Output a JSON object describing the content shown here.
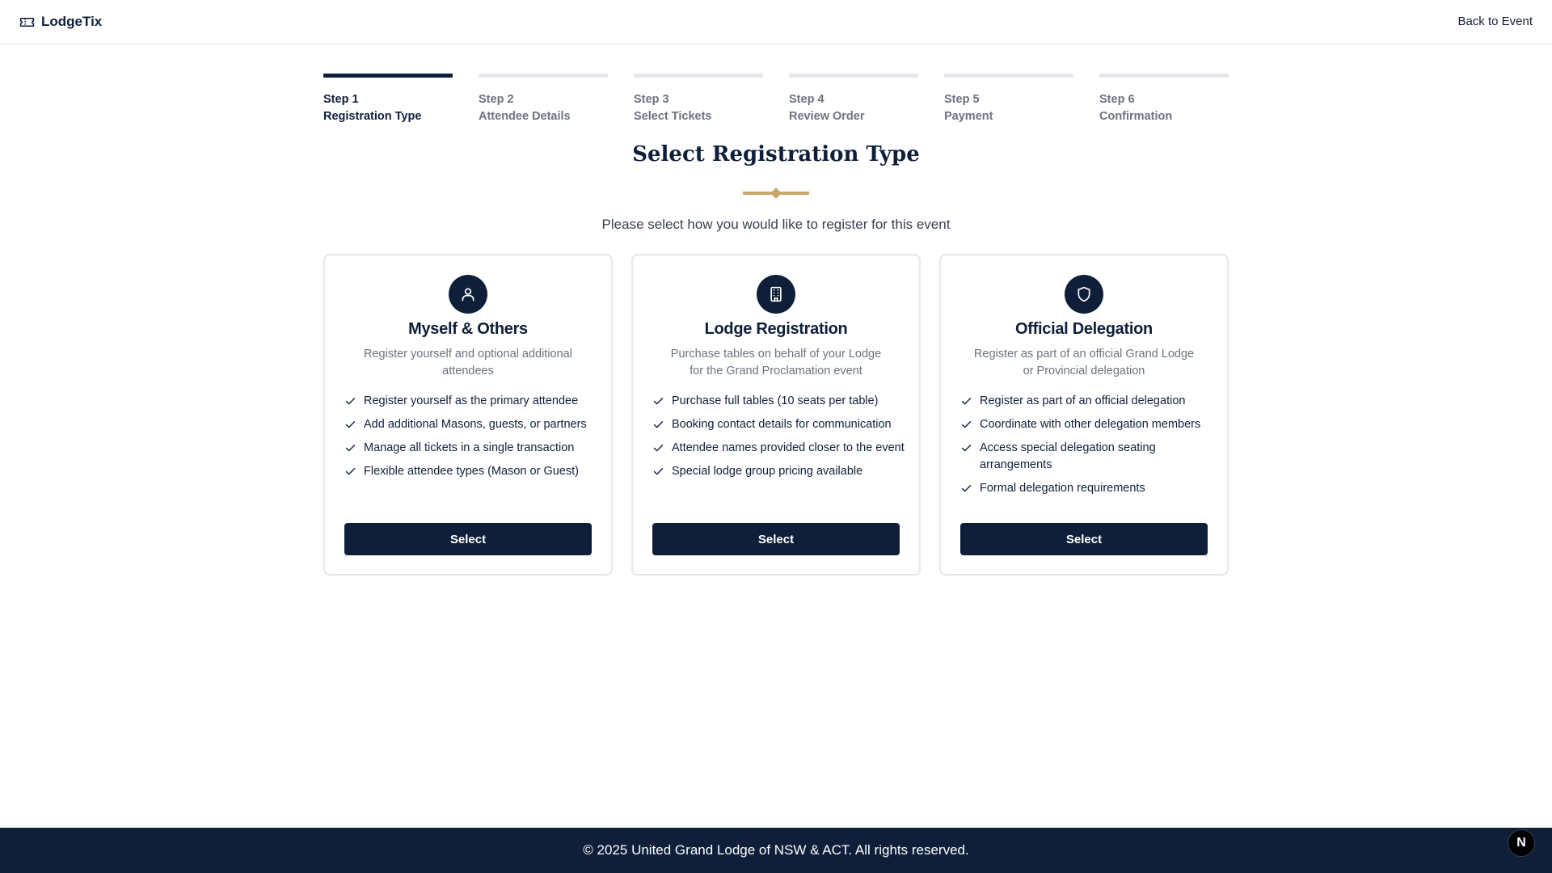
{
  "header": {
    "brand": "LodgeTix",
    "brand_icon": "ticket-icon",
    "back_link": "Back to Event"
  },
  "steps": [
    {
      "num": "Step 1",
      "name": "Registration Type",
      "active": true
    },
    {
      "num": "Step 2",
      "name": "Attendee Details",
      "active": false
    },
    {
      "num": "Step 3",
      "name": "Select Tickets",
      "active": false
    },
    {
      "num": "Step 4",
      "name": "Review Order",
      "active": false
    },
    {
      "num": "Step 5",
      "name": "Payment",
      "active": false
    },
    {
      "num": "Step 6",
      "name": "Confirmation",
      "active": false
    }
  ],
  "page": {
    "title": "Select Registration Type",
    "subtitle": "Please select how you would like to register for this event"
  },
  "cards": [
    {
      "icon": "user-icon",
      "title": "Myself & Others",
      "description": "Register yourself and optional additional attendees",
      "features": [
        "Register yourself as the primary attendee",
        "Add additional Masons, guests, or partners",
        "Manage all tickets in a single transaction",
        "Flexible attendee types (Mason or Guest)"
      ],
      "button": "Select"
    },
    {
      "icon": "building-icon",
      "title": "Lodge Registration",
      "description": "Purchase tables on behalf of your Lodge for the Grand Proclamation event",
      "features": [
        "Purchase full tables (10 seats per table)",
        "Booking contact details for communication",
        "Attendee names provided closer to the event",
        "Special lodge group pricing available"
      ],
      "button": "Select"
    },
    {
      "icon": "shield-icon",
      "title": "Official Delegation",
      "description": "Register as part of an official Grand Lodge or Provincial delegation",
      "features": [
        "Register as part of an official delegation",
        "Coordinate with other delegation members",
        "Access special delegation seating arrangements",
        "Formal delegation requirements"
      ],
      "button": "Select"
    }
  ],
  "footer": {
    "text": "© 2025 United Grand Lodge of NSW & ACT. All rights reserved."
  },
  "dev_badge": "N",
  "colors": {
    "navy": "#0f1f3a",
    "gold": "#c9a66b",
    "muted": "#6b7280",
    "border": "#e5e7eb"
  }
}
